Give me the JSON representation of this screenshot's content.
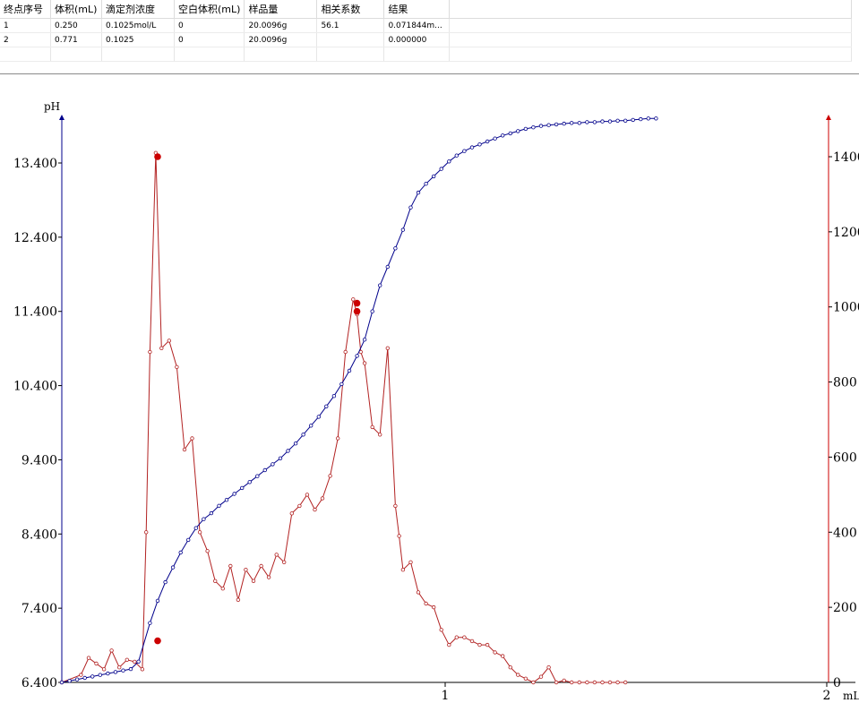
{
  "table": {
    "columns": [
      "终点序号",
      "体积(mL)",
      "滴定剂浓度",
      "空白体积(mL)",
      "样品量",
      "相关系数",
      "结果"
    ],
    "rows": [
      [
        "1",
        "0.250",
        "0.1025mol/L",
        "0",
        "20.0096g",
        "56.1",
        "0.071844m..."
      ],
      [
        "2",
        "0.771",
        "0.1025",
        "0",
        "20.0096g",
        "",
        "0.000000"
      ],
      [
        "",
        "",
        "",
        "",
        "",
        "",
        ""
      ]
    ]
  },
  "colors": {
    "ph_curve": "#00008b",
    "derivative_curve": "#b22222",
    "endpoint_marker": "#cc0000",
    "axis_left": "#00008b",
    "axis_right": "#cc0000"
  },
  "chart_data": {
    "type": "line",
    "xlabel": "mL",
    "ylabel_left": "pH",
    "xlim": [
      0,
      2
    ],
    "ylim_left": [
      6.4,
      14.0
    ],
    "ylim_right": [
      0,
      1500
    ],
    "x_ticks": [
      "1",
      "2"
    ],
    "x_tick_values": [
      1,
      2
    ],
    "y_ticks_left": [
      "6.400",
      "7.400",
      "8.400",
      "9.400",
      "10.400",
      "11.400",
      "12.400",
      "13.400"
    ],
    "y_tick_values_left": [
      6.4,
      7.4,
      8.4,
      9.4,
      10.4,
      11.4,
      12.4,
      13.4
    ],
    "y_ticks_right": [
      "0",
      "200",
      "400",
      "600",
      "800",
      "1000",
      "1200",
      "1400"
    ],
    "y_tick_values_right": [
      0,
      200,
      400,
      600,
      800,
      1000,
      1200,
      1400
    ],
    "grid": false,
    "series": [
      {
        "axis": "left",
        "x": [
          0.0,
          0.02,
          0.04,
          0.06,
          0.08,
          0.1,
          0.12,
          0.14,
          0.16,
          0.18,
          0.2,
          0.23,
          0.25,
          0.27,
          0.29,
          0.31,
          0.33,
          0.35,
          0.37,
          0.39,
          0.41,
          0.43,
          0.45,
          0.47,
          0.49,
          0.51,
          0.53,
          0.55,
          0.57,
          0.59,
          0.61,
          0.63,
          0.65,
          0.67,
          0.69,
          0.71,
          0.73,
          0.75,
          0.77,
          0.79,
          0.81,
          0.83,
          0.85,
          0.87,
          0.89,
          0.91,
          0.93,
          0.95,
          0.97,
          0.99,
          1.01,
          1.03,
          1.05,
          1.07,
          1.09,
          1.11,
          1.13,
          1.15,
          1.17,
          1.19,
          1.21,
          1.23,
          1.25,
          1.27,
          1.29,
          1.31,
          1.33,
          1.35,
          1.37,
          1.39,
          1.41,
          1.43,
          1.45,
          1.47,
          1.49,
          1.51,
          1.53,
          1.55
        ],
        "y": [
          6.4,
          6.42,
          6.44,
          6.46,
          6.48,
          6.5,
          6.52,
          6.54,
          6.56,
          6.58,
          6.68,
          7.2,
          7.5,
          7.75,
          7.95,
          8.15,
          8.32,
          8.48,
          8.6,
          8.68,
          8.78,
          8.86,
          8.94,
          9.02,
          9.1,
          9.18,
          9.26,
          9.34,
          9.42,
          9.52,
          9.62,
          9.74,
          9.86,
          9.98,
          10.12,
          10.26,
          10.42,
          10.6,
          10.8,
          11.02,
          11.4,
          11.75,
          12.0,
          12.25,
          12.5,
          12.8,
          13.0,
          13.12,
          13.22,
          13.32,
          13.42,
          13.5,
          13.56,
          13.61,
          13.65,
          13.69,
          13.73,
          13.77,
          13.8,
          13.83,
          13.86,
          13.88,
          13.9,
          13.91,
          13.92,
          13.93,
          13.94,
          13.94,
          13.95,
          13.95,
          13.96,
          13.96,
          13.97,
          13.97,
          13.98,
          13.99,
          14.0,
          14.0
        ]
      },
      {
        "axis": "right",
        "x": [
          0.0,
          0.05,
          0.07,
          0.09,
          0.11,
          0.13,
          0.15,
          0.17,
          0.19,
          0.21,
          0.22,
          0.23,
          0.245,
          0.26,
          0.28,
          0.3,
          0.32,
          0.34,
          0.36,
          0.38,
          0.4,
          0.42,
          0.44,
          0.46,
          0.48,
          0.5,
          0.52,
          0.54,
          0.56,
          0.58,
          0.6,
          0.62,
          0.64,
          0.66,
          0.68,
          0.7,
          0.72,
          0.74,
          0.76,
          0.77,
          0.78,
          0.79,
          0.81,
          0.83,
          0.85,
          0.87,
          0.88,
          0.89,
          0.91,
          0.93,
          0.95,
          0.97,
          0.99,
          1.01,
          1.03,
          1.05,
          1.07,
          1.09,
          1.11,
          1.13,
          1.15,
          1.17,
          1.19,
          1.21,
          1.23,
          1.25,
          1.27,
          1.29,
          1.31,
          1.33,
          1.35,
          1.37,
          1.39,
          1.41,
          1.43,
          1.45,
          1.47
        ],
        "y": [
          0,
          20,
          65,
          50,
          35,
          85,
          40,
          60,
          55,
          35,
          400,
          880,
          1410,
          890,
          910,
          840,
          620,
          650,
          400,
          350,
          270,
          250,
          310,
          220,
          300,
          270,
          310,
          280,
          340,
          320,
          450,
          470,
          500,
          460,
          490,
          550,
          650,
          880,
          1020,
          980,
          880,
          850,
          680,
          660,
          890,
          470,
          390,
          300,
          320,
          240,
          210,
          200,
          140,
          100,
          120,
          120,
          110,
          100,
          100,
          80,
          70,
          40,
          20,
          10,
          0,
          15,
          40,
          0,
          5,
          0,
          0,
          0,
          0,
          0,
          0,
          0,
          0
        ]
      }
    ],
    "endpoints": [
      {
        "x": 0.25,
        "y_left": 6.96,
        "y_right": 1400
      },
      {
        "x": 0.77,
        "y_left": 11.4,
        "y_right": 1010
      }
    ]
  }
}
